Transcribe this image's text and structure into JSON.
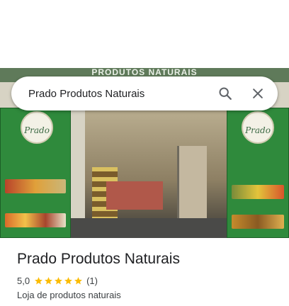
{
  "search": {
    "query": "Prado Produtos Naturais"
  },
  "photo": {
    "sign_text": "PRODUTOS NATURAIS",
    "banner_logo_text": "Prado"
  },
  "place": {
    "name": "Prado Produtos Naturais",
    "rating_value": "5,0",
    "rating_stars": 5,
    "review_count": "(1)",
    "category": "Loja de produtos naturais"
  },
  "colors": {
    "star": "#fbbc04",
    "icon": "#5f6368",
    "banner_green": "#2f8a3c"
  },
  "icons": {
    "search": "search-icon",
    "close": "close-icon",
    "star": "star-icon"
  }
}
